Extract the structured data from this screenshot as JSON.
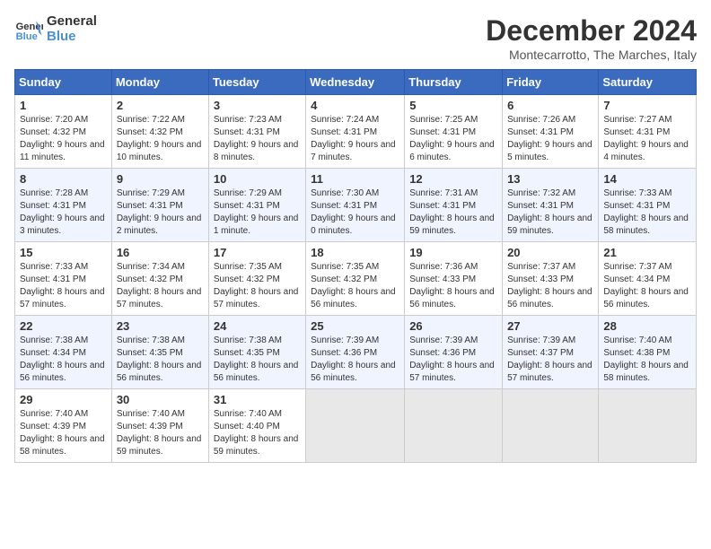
{
  "logo": {
    "line1": "General",
    "line2": "Blue"
  },
  "title": "December 2024",
  "location": "Montecarrotto, The Marches, Italy",
  "weekdays": [
    "Sunday",
    "Monday",
    "Tuesday",
    "Wednesday",
    "Thursday",
    "Friday",
    "Saturday"
  ],
  "weeks": [
    [
      {
        "day": "1",
        "rise": "7:20 AM",
        "set": "4:32 PM",
        "daylight": "9 hours and 11 minutes."
      },
      {
        "day": "2",
        "rise": "7:22 AM",
        "set": "4:32 PM",
        "daylight": "9 hours and 10 minutes."
      },
      {
        "day": "3",
        "rise": "7:23 AM",
        "set": "4:31 PM",
        "daylight": "9 hours and 8 minutes."
      },
      {
        "day": "4",
        "rise": "7:24 AM",
        "set": "4:31 PM",
        "daylight": "9 hours and 7 minutes."
      },
      {
        "day": "5",
        "rise": "7:25 AM",
        "set": "4:31 PM",
        "daylight": "9 hours and 6 minutes."
      },
      {
        "day": "6",
        "rise": "7:26 AM",
        "set": "4:31 PM",
        "daylight": "9 hours and 5 minutes."
      },
      {
        "day": "7",
        "rise": "7:27 AM",
        "set": "4:31 PM",
        "daylight": "9 hours and 4 minutes."
      }
    ],
    [
      {
        "day": "8",
        "rise": "7:28 AM",
        "set": "4:31 PM",
        "daylight": "9 hours and 3 minutes."
      },
      {
        "day": "9",
        "rise": "7:29 AM",
        "set": "4:31 PM",
        "daylight": "9 hours and 2 minutes."
      },
      {
        "day": "10",
        "rise": "7:29 AM",
        "set": "4:31 PM",
        "daylight": "9 hours and 1 minute."
      },
      {
        "day": "11",
        "rise": "7:30 AM",
        "set": "4:31 PM",
        "daylight": "9 hours and 0 minutes."
      },
      {
        "day": "12",
        "rise": "7:31 AM",
        "set": "4:31 PM",
        "daylight": "8 hours and 59 minutes."
      },
      {
        "day": "13",
        "rise": "7:32 AM",
        "set": "4:31 PM",
        "daylight": "8 hours and 59 minutes."
      },
      {
        "day": "14",
        "rise": "7:33 AM",
        "set": "4:31 PM",
        "daylight": "8 hours and 58 minutes."
      }
    ],
    [
      {
        "day": "15",
        "rise": "7:33 AM",
        "set": "4:31 PM",
        "daylight": "8 hours and 57 minutes."
      },
      {
        "day": "16",
        "rise": "7:34 AM",
        "set": "4:32 PM",
        "daylight": "8 hours and 57 minutes."
      },
      {
        "day": "17",
        "rise": "7:35 AM",
        "set": "4:32 PM",
        "daylight": "8 hours and 57 minutes."
      },
      {
        "day": "18",
        "rise": "7:35 AM",
        "set": "4:32 PM",
        "daylight": "8 hours and 56 minutes."
      },
      {
        "day": "19",
        "rise": "7:36 AM",
        "set": "4:33 PM",
        "daylight": "8 hours and 56 minutes."
      },
      {
        "day": "20",
        "rise": "7:37 AM",
        "set": "4:33 PM",
        "daylight": "8 hours and 56 minutes."
      },
      {
        "day": "21",
        "rise": "7:37 AM",
        "set": "4:34 PM",
        "daylight": "8 hours and 56 minutes."
      }
    ],
    [
      {
        "day": "22",
        "rise": "7:38 AM",
        "set": "4:34 PM",
        "daylight": "8 hours and 56 minutes."
      },
      {
        "day": "23",
        "rise": "7:38 AM",
        "set": "4:35 PM",
        "daylight": "8 hours and 56 minutes."
      },
      {
        "day": "24",
        "rise": "7:38 AM",
        "set": "4:35 PM",
        "daylight": "8 hours and 56 minutes."
      },
      {
        "day": "25",
        "rise": "7:39 AM",
        "set": "4:36 PM",
        "daylight": "8 hours and 56 minutes."
      },
      {
        "day": "26",
        "rise": "7:39 AM",
        "set": "4:36 PM",
        "daylight": "8 hours and 57 minutes."
      },
      {
        "day": "27",
        "rise": "7:39 AM",
        "set": "4:37 PM",
        "daylight": "8 hours and 57 minutes."
      },
      {
        "day": "28",
        "rise": "7:40 AM",
        "set": "4:38 PM",
        "daylight": "8 hours and 58 minutes."
      }
    ],
    [
      {
        "day": "29",
        "rise": "7:40 AM",
        "set": "4:39 PM",
        "daylight": "8 hours and 58 minutes."
      },
      {
        "day": "30",
        "rise": "7:40 AM",
        "set": "4:39 PM",
        "daylight": "8 hours and 59 minutes."
      },
      {
        "day": "31",
        "rise": "7:40 AM",
        "set": "4:40 PM",
        "daylight": "8 hours and 59 minutes."
      },
      null,
      null,
      null,
      null
    ]
  ],
  "labels": {
    "sunrise": "Sunrise:",
    "sunset": "Sunset:",
    "daylight": "Daylight:"
  }
}
